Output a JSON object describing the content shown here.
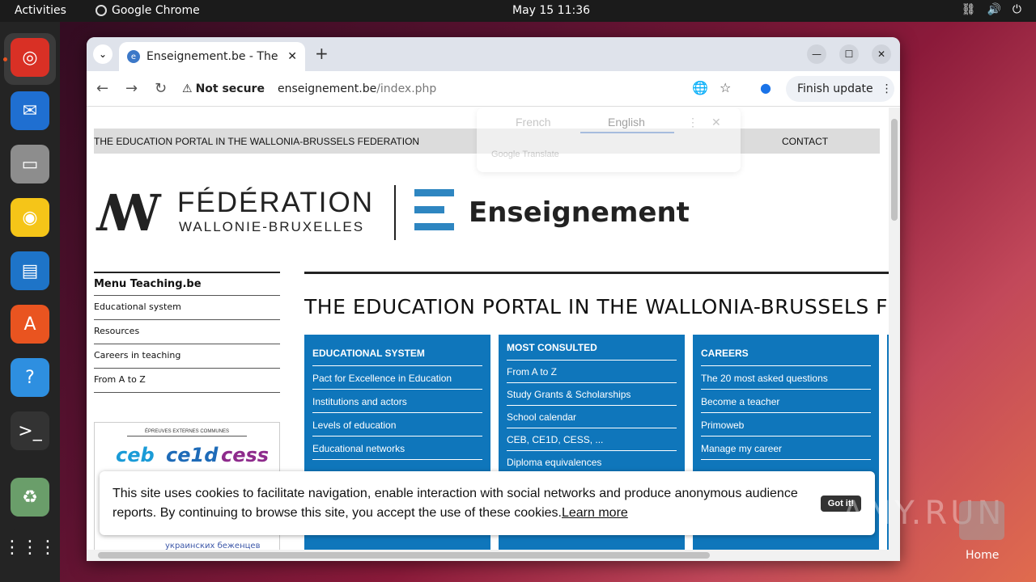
{
  "topbar": {
    "activities": "Activities",
    "app_name": "Google Chrome",
    "clock": "May 15  11:36",
    "tray_network": "⛓",
    "tray_volume": "🔊",
    "tray_power": "⏻"
  },
  "dock": {
    "items": [
      {
        "name": "chrome",
        "glyph": "◎",
        "color": "#d93025"
      },
      {
        "name": "thunderbird",
        "glyph": "✉",
        "color": "#1f6fd1"
      },
      {
        "name": "files",
        "glyph": "▭",
        "color": "#8d8d8d"
      },
      {
        "name": "rhythmbox",
        "glyph": "◉",
        "color": "#f5c518"
      },
      {
        "name": "writer",
        "glyph": "▤",
        "color": "#1e74c8"
      },
      {
        "name": "app-center",
        "glyph": "A",
        "color": "#e95420"
      },
      {
        "name": "help",
        "glyph": "?",
        "color": "#2e8fe0"
      },
      {
        "name": "terminal",
        "glyph": ">_",
        "color": "#333333"
      },
      {
        "name": "trash",
        "glyph": "♻",
        "color": "#6a9e6a"
      },
      {
        "name": "show-apps",
        "glyph": "⋮⋮⋮",
        "color": "#242424"
      }
    ]
  },
  "browser": {
    "tab_title": "Enseignement.be - The E",
    "tab_close": "✕",
    "new_tab": "+",
    "tab_dropdown": "⌄",
    "win_minimize": "—",
    "win_maximize": "☐",
    "win_close": "✕",
    "back": "←",
    "forward": "→",
    "reload": "↻",
    "not_secure": "Not secure",
    "url_host": "enseignement.be",
    "url_path": "/index.php",
    "finish_update": "Finish update",
    "kebab": "⋮"
  },
  "translate": {
    "lang_from": "French",
    "lang_to": "English",
    "brand": "Google Translate",
    "more": "⋮",
    "close": "✕"
  },
  "page": {
    "topbar_left": "THE EDUCATION PORTAL IN THE WALLONIA-BRUSSELS FEDERATION",
    "topbar_right": "CONTACT",
    "logo_line1": "FÉDÉRATION",
    "logo_line2": "WALLONIE-BRUXELLES",
    "logo_brand": "Enseignement",
    "menu_title": "Menu Teaching.be",
    "menu_items": [
      "Educational system",
      "Resources",
      "Careers in teaching",
      "From A to Z"
    ],
    "exams_header": "ÉPREUVES EXTERNES COMMUNES",
    "exams_logos": [
      "ceb",
      "ce1d",
      "cess"
    ],
    "ukr_text": "украинских беженцев",
    "main_title": "THE EDUCATION PORTAL IN THE WALLONIA-BRUSSELS F",
    "columns": [
      {
        "title": "EDUCATIONAL SYSTEM",
        "items": [
          "Pact for Excellence in Education",
          "Institutions and actors",
          "Levels of education",
          "Educational networks"
        ]
      },
      {
        "title": "MOST CONSULTED",
        "items": [
          "From A to Z",
          "Study Grants & Scholarships",
          "School calendar",
          "CEB, CE1D, CESS, ...",
          "Diploma equivalences"
        ]
      },
      {
        "title": "CAREERS",
        "items": [
          "The 20 most asked questions",
          "Become a teacher",
          "Primoweb",
          "Manage my career"
        ]
      }
    ]
  },
  "cookie": {
    "text": "This site uses cookies to facilitate navigation, enable interaction with social networks and produce anonymous audience reports. By continuing to browse this site, you accept the use of these cookies.",
    "learn_more": "Learn more",
    "got_it": "Got it!"
  },
  "watermark": {
    "text": "ANY.RUN",
    "home_label": "Home"
  },
  "colors": {
    "portal_blue": "#0f76bb",
    "logo_blue": "#2e86c1",
    "ubuntu_orange": "#e95420"
  }
}
